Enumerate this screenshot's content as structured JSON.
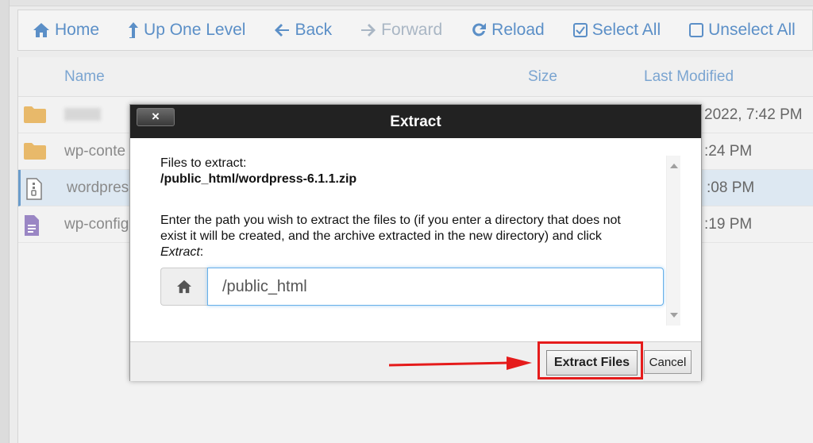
{
  "toolbar": {
    "home": "Home",
    "up_one_level": "Up One Level",
    "back": "Back",
    "forward": "Forward",
    "reload": "Reload",
    "select_all": "Select All",
    "unselect_all": "Unselect All"
  },
  "columns": {
    "name": "Name",
    "size": "Size",
    "last_modified": "Last Modified"
  },
  "files": [
    {
      "icon": "folder-icon",
      "name": "",
      "modified": "2022, 7:42 PM",
      "blurred": true
    },
    {
      "icon": "folder-icon",
      "name": "wp-conte",
      "modified": ":24 PM"
    },
    {
      "icon": "zip-file-icon",
      "name": "wordpres",
      "modified": ":08 PM",
      "selected": true
    },
    {
      "icon": "text-file-icon",
      "name": "wp-config",
      "modified": ":19 PM"
    }
  ],
  "dialog": {
    "title": "Extract",
    "close_label": "×",
    "files_to_extract_label": "Files to extract:",
    "file_path": "/public_html/wordpress-6.1.1.zip",
    "instructions_prefix": "Enter the path you wish to extract the files to (if you enter a directory that does not exist it will be created, and the archive extracted in the new directory) and click ",
    "instructions_emphasis": "Extract",
    "instructions_suffix": ":",
    "path_value": "/public_html",
    "extract_button": "Extract Files",
    "cancel_button": "Cancel"
  },
  "colors": {
    "accent": "#5b8fc7",
    "highlight": "#e51b1b",
    "title_bar": "#222222"
  }
}
